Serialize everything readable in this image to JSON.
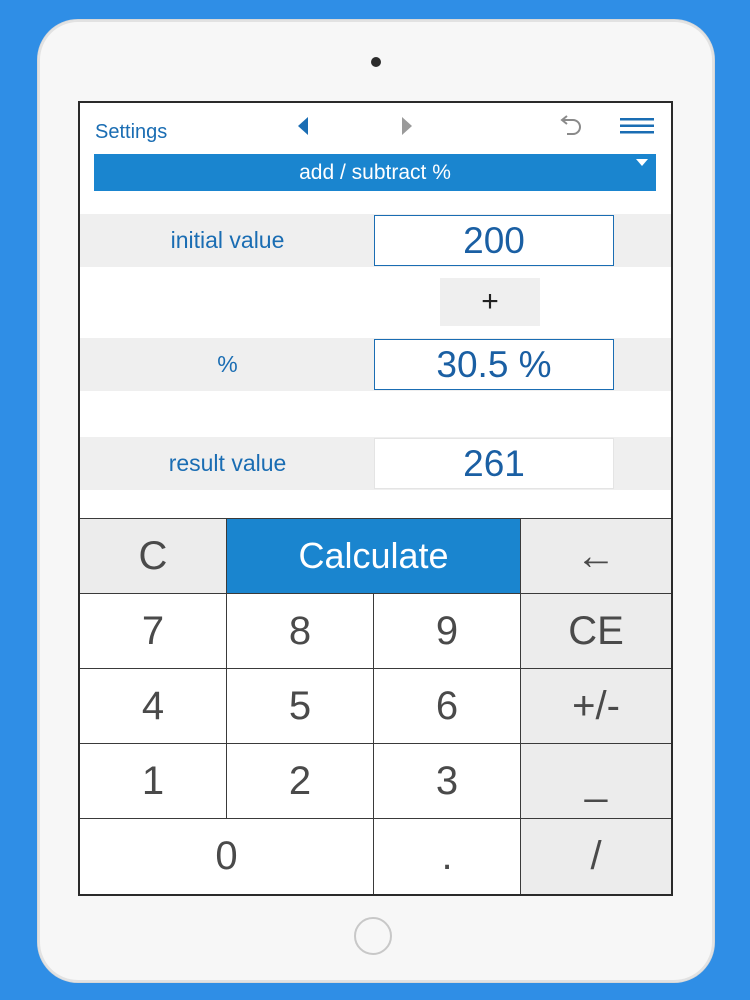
{
  "topbar": {
    "settings_label": "Settings",
    "icons": [
      "nav-left-icon",
      "nav-right-icon",
      "undo-icon",
      "menu-icon"
    ]
  },
  "mode": {
    "selected": "add / subtract %"
  },
  "form": {
    "initial_label": "initial value",
    "initial_value": "200",
    "operator": "+",
    "percent_label": "%",
    "percent_value": "30.5 %",
    "result_label": "result value",
    "result_value": "261"
  },
  "keypad": {
    "clear": "C",
    "calculate": "Calculate",
    "backspace": "←",
    "k7": "7",
    "k8": "8",
    "k9": "9",
    "ce": "CE",
    "k4": "4",
    "k5": "5",
    "k6": "6",
    "sign": "+/-",
    "k1": "1",
    "k2": "2",
    "k3": "3",
    "underscore": "_",
    "k0": "0",
    "dot": ".",
    "slash": "/"
  },
  "colors": {
    "background": "#2f8ee6",
    "accent": "#1a85cf",
    "text_blue": "#1a6db3"
  }
}
